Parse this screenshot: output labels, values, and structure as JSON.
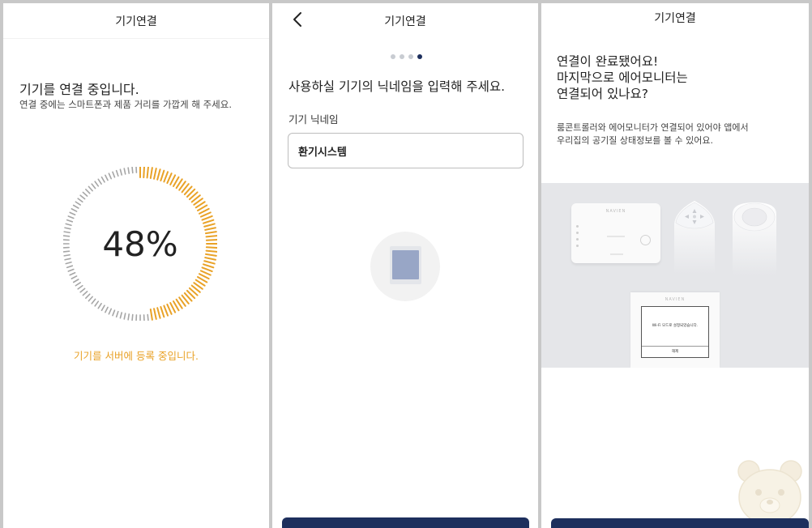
{
  "panel1": {
    "title": "기기연결",
    "heading": "기기를 연결 중입니다.",
    "subtext": "연결 중에는 스마트폰과 제품 거리를 가깝게 해 주세요.",
    "progress_label": "48%",
    "progress_fraction": 0.48,
    "status": "기기를 서버에 등록 중입니다.",
    "colors": {
      "progress": "#e9a227",
      "track": "#a6a6a6"
    }
  },
  "panel2": {
    "title": "기기연결",
    "back_icon": "chevron-left-icon",
    "steps_total": 4,
    "step_current": 4,
    "heading": "사용하실 기기의 닉네임을 입력해 주세요.",
    "field_label": "기기 닉네임",
    "nickname_value": "환기시스템",
    "colors": {
      "accent": "#1d2f5d",
      "device": "#98a6c6"
    }
  },
  "panel3": {
    "title": "기기연결",
    "heading_lines": [
      "연결이 완료됐어요!",
      "마지막으로 에어모니터는",
      "연결되어 있나요?"
    ],
    "desc_lines": [
      "룸콘트롤러와 에어모니터가 연결되어 있어야 앱에서",
      "우리집의 공기질 상태정보를 볼 수 있어요."
    ],
    "illustration": {
      "hub_brand": "NAVIEN",
      "panel_brand": "NAVIEN",
      "panel_message": "Wi-Fi 모드로 설정되었습니다.",
      "panel_button": "해제"
    },
    "watermark_icon": "bear-face-icon",
    "colors": {
      "accent": "#1d2f5d",
      "illustration_bg": "#e5e6e9"
    }
  }
}
